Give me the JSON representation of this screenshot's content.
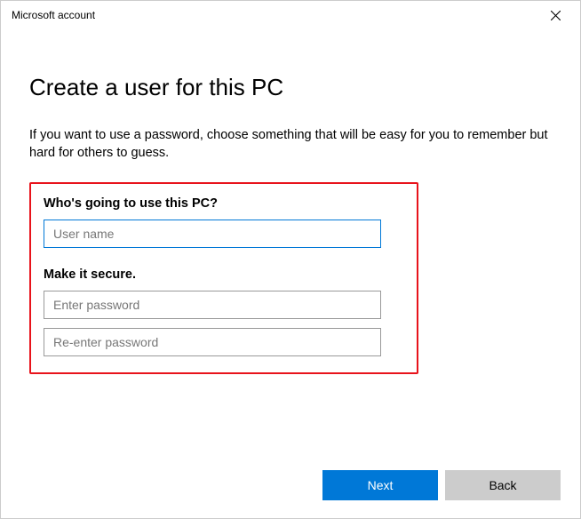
{
  "window": {
    "title": "Microsoft account"
  },
  "main": {
    "heading": "Create a user for this PC",
    "description": "If you want to use a password, choose something that will be easy for you to remember but hard for others to guess.",
    "section_user_label": "Who's going to use this PC?",
    "username_placeholder": "User name",
    "username_value": "",
    "section_secure_label": "Make it secure.",
    "password_placeholder": "Enter password",
    "password_value": "",
    "password2_placeholder": "Re-enter password",
    "password2_value": ""
  },
  "footer": {
    "next_label": "Next",
    "back_label": "Back"
  }
}
